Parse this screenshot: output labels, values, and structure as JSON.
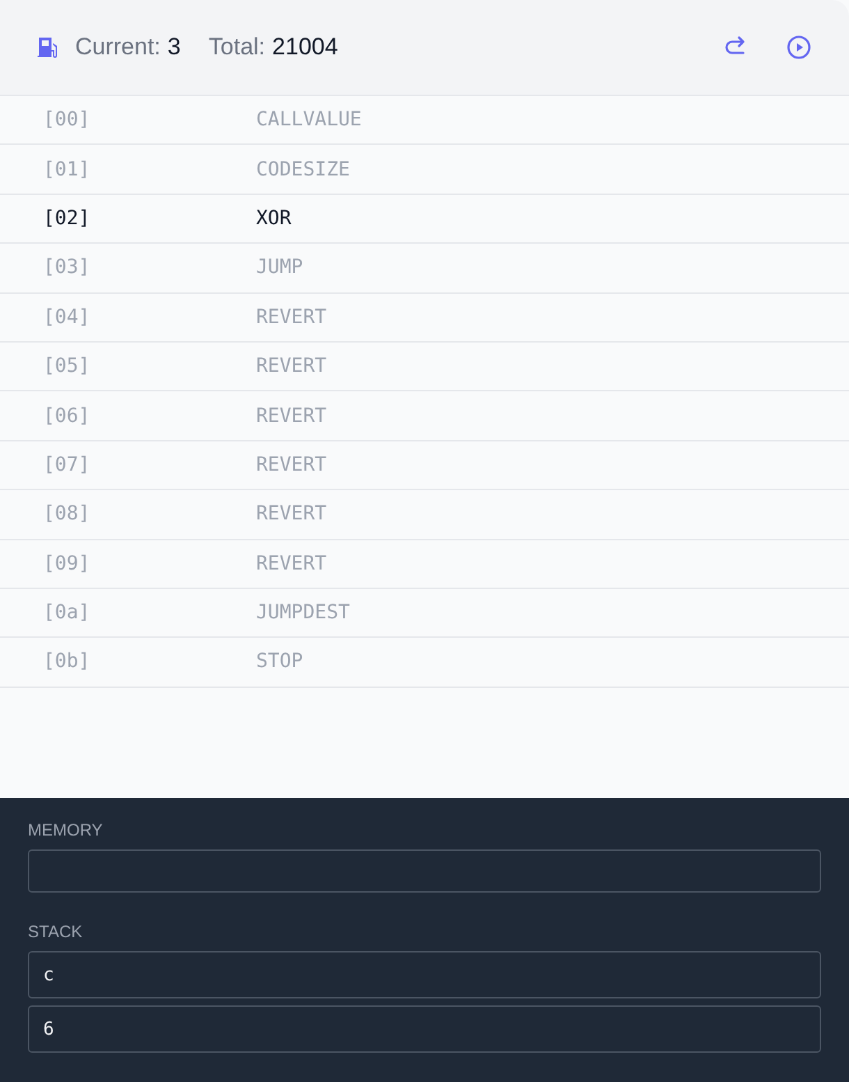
{
  "header": {
    "current_label": "Current:",
    "current": "3",
    "total_label": "Total:",
    "total": "21004"
  },
  "instructions": [
    {
      "offset": "[00]",
      "opcode": "CALLVALUE",
      "selected": false
    },
    {
      "offset": "[01]",
      "opcode": "CODESIZE",
      "selected": false
    },
    {
      "offset": "[02]",
      "opcode": "XOR",
      "selected": true
    },
    {
      "offset": "[03]",
      "opcode": "JUMP",
      "selected": false
    },
    {
      "offset": "[04]",
      "opcode": "REVERT",
      "selected": false
    },
    {
      "offset": "[05]",
      "opcode": "REVERT",
      "selected": false
    },
    {
      "offset": "[06]",
      "opcode": "REVERT",
      "selected": false
    },
    {
      "offset": "[07]",
      "opcode": "REVERT",
      "selected": false
    },
    {
      "offset": "[08]",
      "opcode": "REVERT",
      "selected": false
    },
    {
      "offset": "[09]",
      "opcode": "REVERT",
      "selected": false
    },
    {
      "offset": "[0a]",
      "opcode": "JUMPDEST",
      "selected": false
    },
    {
      "offset": "[0b]",
      "opcode": "STOP",
      "selected": false
    }
  ],
  "memory": {
    "label": "MEMORY"
  },
  "stack": {
    "label": "STACK",
    "items": [
      "c",
      "6"
    ]
  }
}
